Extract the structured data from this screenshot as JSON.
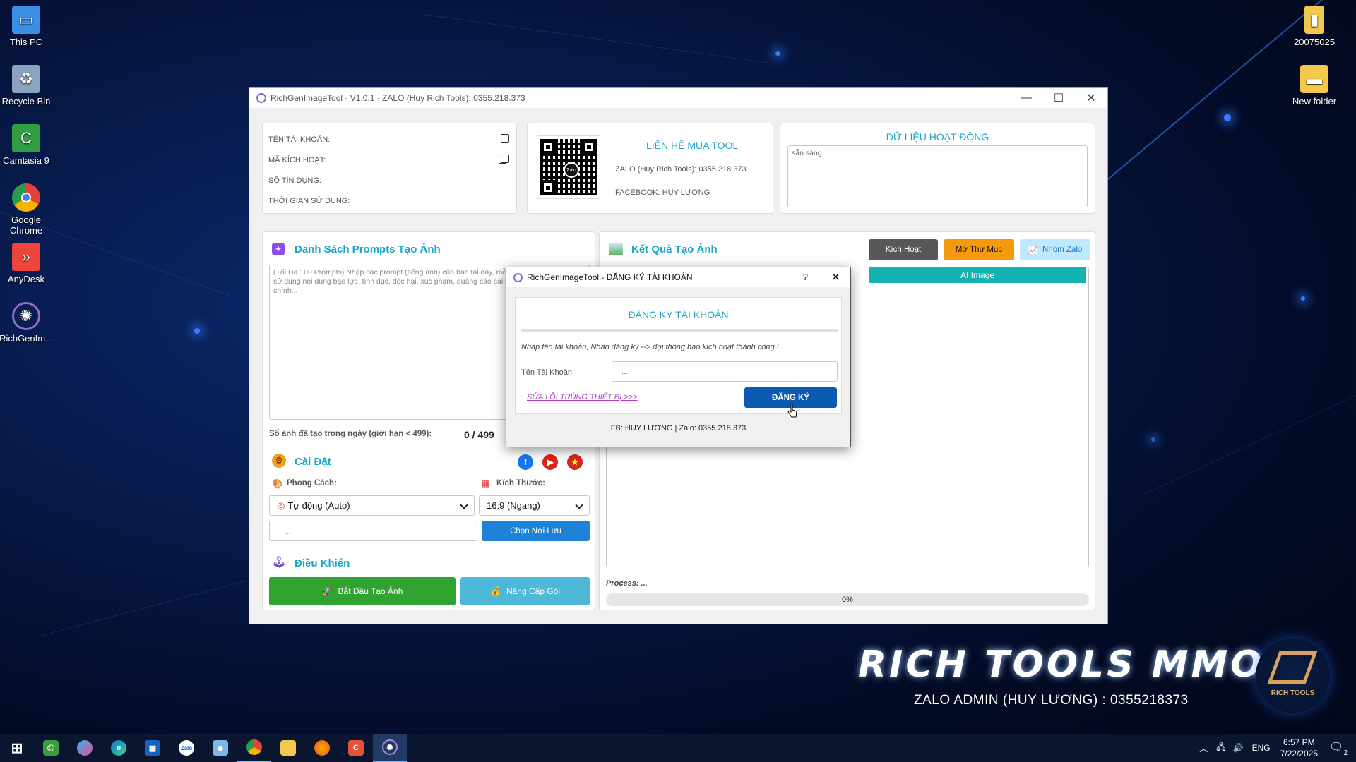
{
  "desktop": {
    "icons_left": [
      {
        "label": "This PC",
        "icon": "computer-icon",
        "color": "#3a8ee6"
      },
      {
        "label": "Recycle Bin",
        "icon": "recycle-bin-icon",
        "color": "#8aa4c0"
      },
      {
        "label": "Camtasia 9",
        "icon": "camtasia-icon",
        "color": "#2f9e44"
      },
      {
        "label": "Google Chrome",
        "icon": "chrome-icon",
        "color": "#e5433a"
      },
      {
        "label": "AnyDesk",
        "icon": "anydesk-icon",
        "color": "#ef443b"
      },
      {
        "label": "RichGenIm...",
        "icon": "richgen-icon",
        "color": "#6a59b5"
      }
    ],
    "icons_right": [
      {
        "label": "20075025",
        "icon": "zip-file-icon"
      },
      {
        "label": "New folder",
        "icon": "folder-icon"
      }
    ]
  },
  "main_window": {
    "title": "RichGenImageTool  -  V1.0.1  -  ZALO (Huy Rich Tools):  0355.218.373",
    "account": {
      "username_label": "TÊN TÀI KHOẢN:",
      "activation_label": "MÃ KÍCH HOẠT:",
      "credits_label": "SỐ TÍN DỤNG:",
      "usage_time_label": "THỜI GIAN SỬ DỤNG:"
    },
    "contact": {
      "title": "LIÊN HỆ MUA TOOL",
      "zalo": "ZALO (Huy Rich Tools):   0355.218.373",
      "facebook": "FACEBOOK:   HUY LƯƠNG",
      "qr_center": "Zalo"
    },
    "activity": {
      "title": "DỮ LIỆU HOẠT ĐỘNG",
      "log": "sẵn sàng ..."
    },
    "prompts": {
      "title": "Danh Sách Prompts Tạo Ảnh",
      "placeholder": "(Tối Đa 100 Prompts)  Nhập các prompt (tiếng anh) của bạn tại đây, mỗi dòng 1 prompt. Không sử dụng nội dung bạo lực, tình dục, độc hại, xúc phạm, quảng cáo sai sự thật về y tế hoặc tài chính...",
      "count_label": "Số ảnh đã tạo trong ngày (giới hạn < 499):",
      "count_value": "0 / 499"
    },
    "settings": {
      "title": "Cài Đặt",
      "style_label": "Phong Cách:",
      "style_value": "Tự động (Auto)",
      "size_label": "Kích Thước:",
      "size_value": "16:9 (Ngang)",
      "save_path": "...",
      "choose_folder": "Chọn Nơi Lưu"
    },
    "control": {
      "title": "Điều Khiển",
      "start": "Bắt Đầu Tạo Ảnh",
      "upgrade": "Nâng Cấp Gói"
    },
    "results": {
      "title": "Kết Quả Tạo Ảnh",
      "activate": "Kích Hoạt",
      "open_folder": "Mở Thư Mục",
      "zalo_group": "Nhóm Zalo",
      "column_ai_image": "AI Image",
      "process_label": "Process: ...",
      "progress_text": "0%",
      "progress": 0
    }
  },
  "dialog": {
    "title": "RichGenImageTool  -  ĐĂNG KÝ TÀI KHOẢN",
    "help": "?",
    "heading": "ĐĂNG KÝ TÀI KHOẢN",
    "instruction": "Nhập tên tài khoản, Nhấn đăng ký --> đợi thông báo kích hoạt thành công !",
    "username_label": "Tên Tài Khoản:",
    "username_value": "...",
    "fix_link": "SỬA LỖI TRÙNG THIẾT BỊ >>>",
    "register_button": "ĐĂNG KÝ",
    "footer": "FB: HUY LƯƠNG | Zalo:  0355.218.373"
  },
  "branding": {
    "headline": "RICH TOOLS MMO",
    "sub": "ZALO ADMIN (HUY LƯƠNG) : 0355218373",
    "logo_text": "RICH TOOLS"
  },
  "taskbar": {
    "apps": [
      "start-icon",
      "mail-icon",
      "copilot-icon",
      "edge-icon",
      "store-icon",
      "zalo-icon",
      "app-icon",
      "chrome-icon",
      "explorer-icon",
      "firefox-icon",
      "camtasia-icon",
      "richgen-icon"
    ],
    "lang": "ENG",
    "time": "6:57 PM",
    "date": "7/22/2025",
    "notifications": "2"
  }
}
